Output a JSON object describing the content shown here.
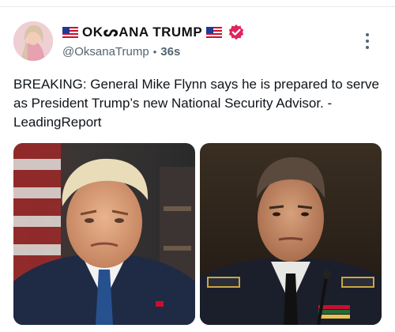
{
  "post": {
    "display_name": "OKᔕANA TRUMP",
    "handle": "@OksanaTrump",
    "separator": "•",
    "time": "36s",
    "text": "BREAKING: General Mike Flynn says he is prepared to serve as President Trump’s new National Security Advisor. -LeadingReport"
  },
  "icons": {
    "flag_left": "us-flag-icon",
    "flag_right": "us-flag-icon",
    "verified": "verified-badge-icon",
    "more": "more-vertical-icon"
  },
  "colors": {
    "verified_badge": "#e0245e",
    "secondary_text": "#536471"
  }
}
